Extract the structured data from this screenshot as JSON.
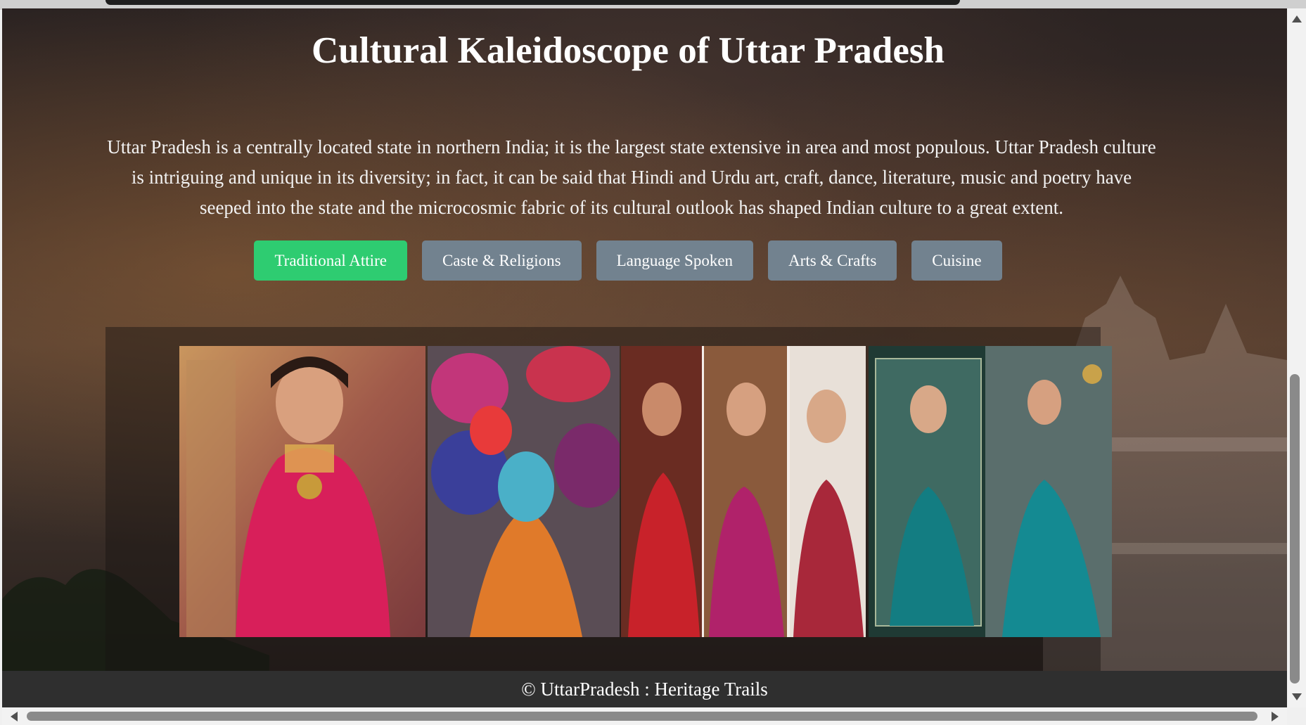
{
  "page": {
    "title": "Cultural Kaleidoscope of Uttar Pradesh",
    "intro": "Uttar Pradesh is a centrally located state in northern India; it is the largest state extensive in area and most populous. Uttar Pradesh culture is intriguing and unique in its diversity; in fact, it can be said that Hindi and Urdu art, craft, dance, literature, music and poetry have seeped into the state and the microcosmic fabric of its cultural outlook has shaped Indian culture to a great extent."
  },
  "tabs": [
    {
      "label": "Traditional Attire",
      "active": true
    },
    {
      "label": "Caste & Religions",
      "active": false
    },
    {
      "label": "Language Spoken",
      "active": false
    },
    {
      "label": "Arts & Crafts",
      "active": false
    },
    {
      "label": "Cuisine",
      "active": false
    }
  ],
  "colors": {
    "active_tab": "#2ecc71",
    "inactive_tab": "#72828f",
    "footer_bg": "#2f2f2f"
  },
  "gallery": {
    "images": [
      {
        "name": "bride-red-saree-photo"
      },
      {
        "name": "dancers-ghagra-photo"
      },
      {
        "name": "red-saree-collage-photo"
      },
      {
        "name": "teal-saree-photo"
      }
    ]
  },
  "footer": {
    "text": "© UttarPradesh : Heritage Trails"
  }
}
